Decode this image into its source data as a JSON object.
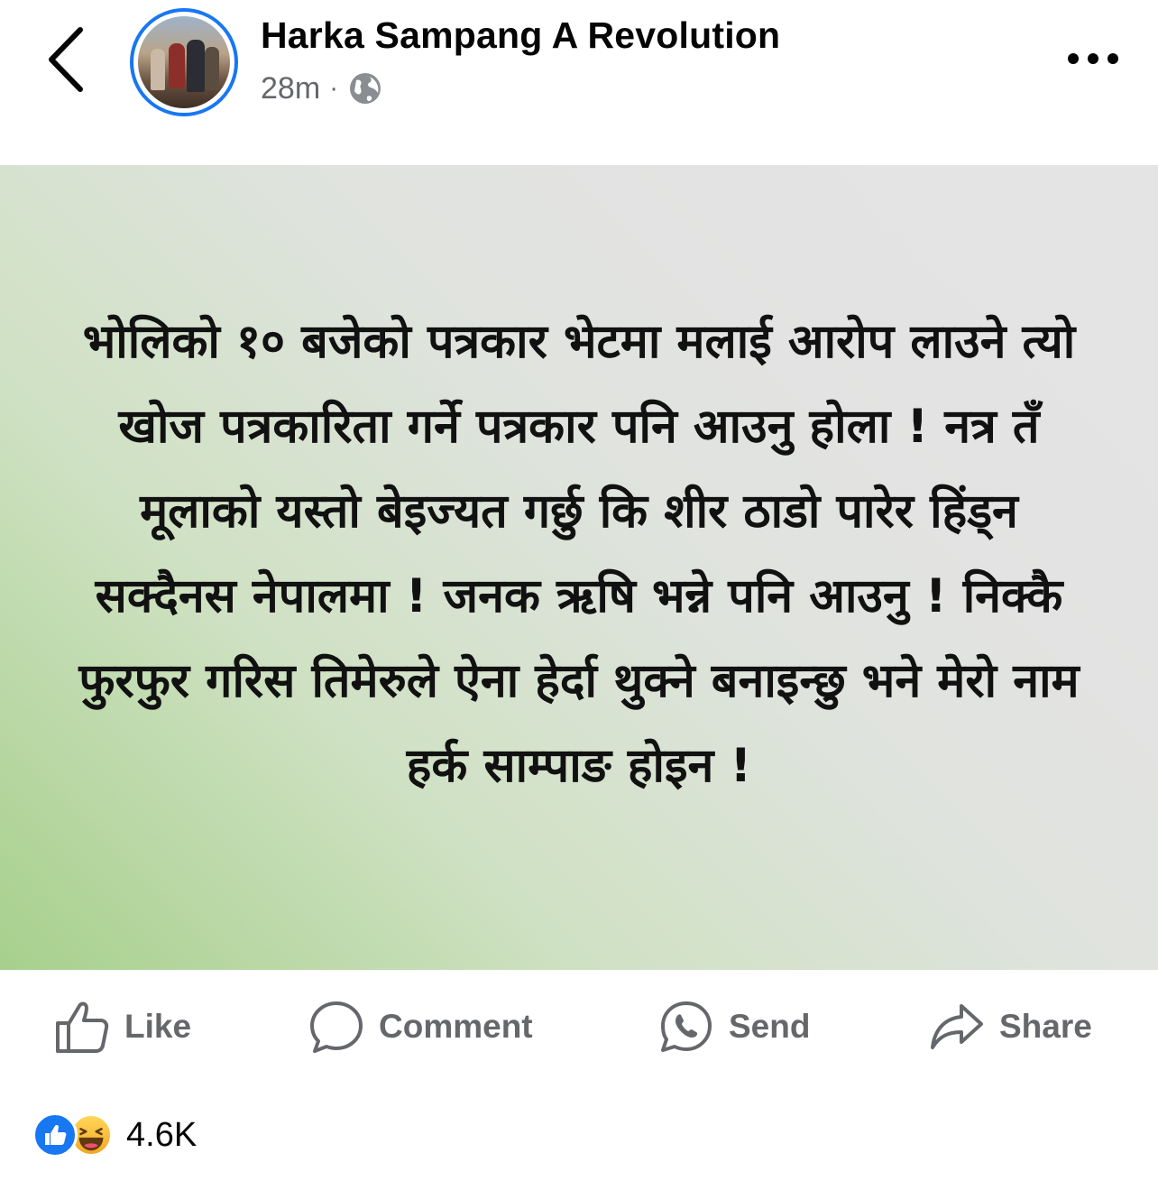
{
  "header": {
    "page_name": "Harka Sampang A Revolution",
    "time": "28m",
    "separator": "·",
    "back_icon": "chevron-left-icon",
    "audience_icon": "globe-icon",
    "more_icon": "more-horizontal-icon"
  },
  "post": {
    "text": "भोलिको १० बजेको पत्रकार भेटमा मलाई आरोप लाउने त्यो खोज पत्रकारिता गर्ने पत्रकार पनि आउनु होला ! नत्र तँ मूलाको यस्तो बेइज्यत गर्छु कि शीर ठाडो पारेर हिंड्न सक्दैनस नेपालमा ! जनक ऋषि भन्ने पनि आउनु ! निक्कै फुरफुर गरिस तिमेरुले ऐना हेर्दा थुक्ने बनाइन्छु भने मेरो नाम हर्क साम्पाङ होइन !",
    "bg_colors": [
      "#a7d08c",
      "#e4e4e4"
    ]
  },
  "actions": {
    "like": "Like",
    "comment": "Comment",
    "send": "Send",
    "share": "Share"
  },
  "reactions": {
    "count": "4.6K",
    "types": [
      "like",
      "haha"
    ]
  },
  "colors": {
    "brand_blue": "#1877f2",
    "secondary_text": "#65676b"
  }
}
